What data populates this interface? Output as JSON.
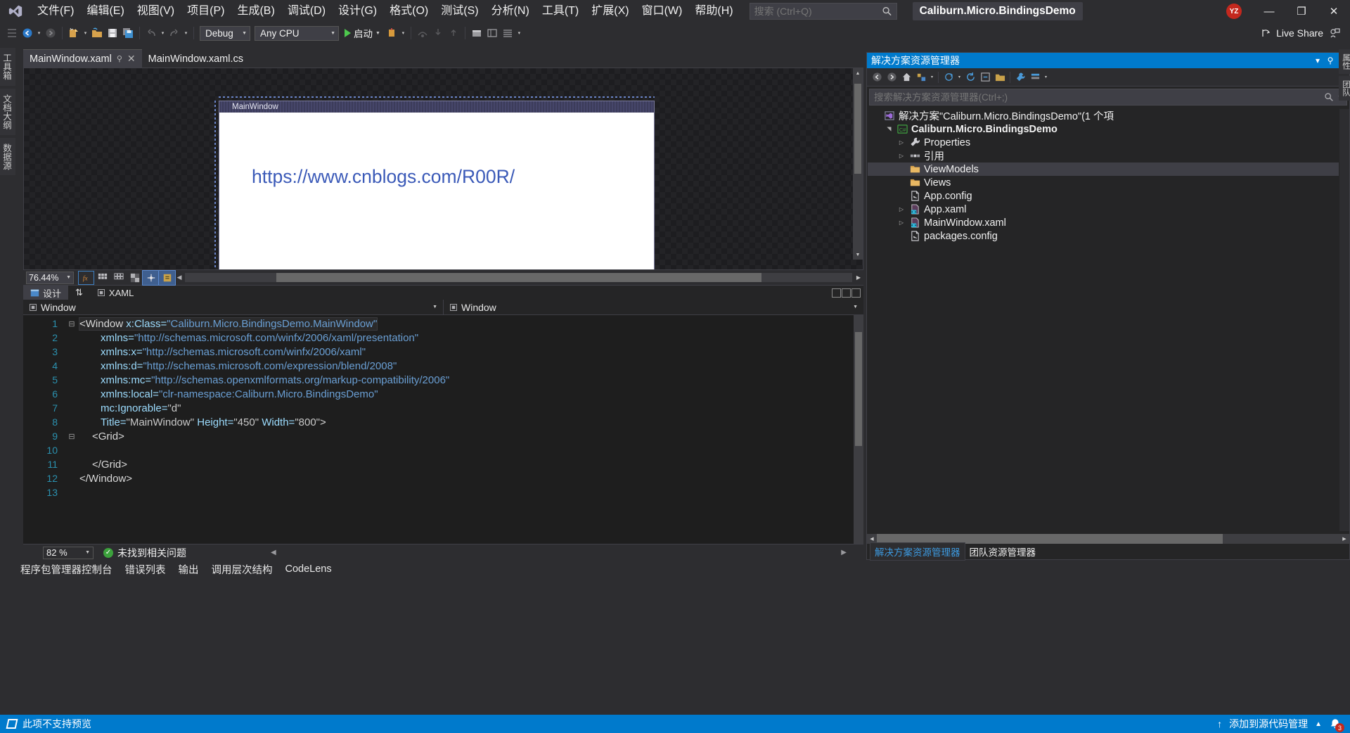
{
  "app": {
    "solution_name": "Caliburn.Micro.BindingsDemo",
    "account_initials": "YZ"
  },
  "menubar": {
    "items": [
      {
        "label": "文件(F)"
      },
      {
        "label": "编辑(E)"
      },
      {
        "label": "视图(V)"
      },
      {
        "label": "项目(P)"
      },
      {
        "label": "生成(B)"
      },
      {
        "label": "调试(D)"
      },
      {
        "label": "设计(G)"
      },
      {
        "label": "格式(O)"
      },
      {
        "label": "测试(S)"
      },
      {
        "label": "分析(N)"
      },
      {
        "label": "工具(T)"
      },
      {
        "label": "扩展(X)"
      },
      {
        "label": "窗口(W)"
      },
      {
        "label": "帮助(H)"
      }
    ],
    "search_placeholder": "搜索 (Ctrl+Q)",
    "minimize": "—",
    "maximize": "❐",
    "close": "✕"
  },
  "toolbar": {
    "config": "Debug",
    "platform": "Any CPU",
    "run_label": "启动",
    "live_share": "Live Share"
  },
  "left_rail": {
    "items": [
      "工具箱",
      "文档大纲",
      "数据源"
    ]
  },
  "doc_tabs": [
    {
      "label": "MainWindow.xaml",
      "active": true
    },
    {
      "label": "MainWindow.xaml.cs",
      "active": false
    }
  ],
  "designer": {
    "window_title": "MainWindow",
    "url_text": "https://www.cnblogs.com/R00R/",
    "url_color": "#3b5ab8",
    "zoom": "76.44%"
  },
  "split_tabs": {
    "design": "设计",
    "swap": "⇅",
    "xaml": "XAML"
  },
  "breadcrumbs": {
    "left": "Window",
    "right": "Window"
  },
  "code": {
    "lines": [
      {
        "n": "1",
        "fold": "⊟",
        "indent": 0,
        "tokens": [
          {
            "t": "<Window ",
            "c": "tk-elem"
          },
          {
            "t": "x:Class=",
            "c": "tk-attr"
          },
          {
            "t": "\"Caliburn.Micro.BindingsDemo.MainWindow\"",
            "c": "tk-ns"
          }
        ]
      },
      {
        "n": "2",
        "fold": "",
        "indent": 1,
        "tokens": [
          {
            "t": "xmlns=",
            "c": "tk-attr"
          },
          {
            "t": "\"http://schemas.microsoft.com/winfx/2006/xaml/presentation\"",
            "c": "tk-ns"
          }
        ]
      },
      {
        "n": "3",
        "fold": "",
        "indent": 1,
        "tokens": [
          {
            "t": "xmlns:x=",
            "c": "tk-attr"
          },
          {
            "t": "\"http://schemas.microsoft.com/winfx/2006/xaml\"",
            "c": "tk-ns"
          }
        ]
      },
      {
        "n": "4",
        "fold": "",
        "indent": 1,
        "tokens": [
          {
            "t": "xmlns:d=",
            "c": "tk-attr"
          },
          {
            "t": "\"http://schemas.microsoft.com/expression/blend/2008\"",
            "c": "tk-ns"
          }
        ]
      },
      {
        "n": "5",
        "fold": "",
        "indent": 1,
        "tokens": [
          {
            "t": "xmlns:mc=",
            "c": "tk-attr"
          },
          {
            "t": "\"http://schemas.openxmlformats.org/markup-compatibility/2006\"",
            "c": "tk-ns"
          }
        ]
      },
      {
        "n": "6",
        "fold": "",
        "indent": 1,
        "tokens": [
          {
            "t": "xmlns:local=",
            "c": "tk-attr"
          },
          {
            "t": "\"clr-namespace:Caliburn.Micro.BindingsDemo\"",
            "c": "tk-ns"
          }
        ]
      },
      {
        "n": "7",
        "fold": "",
        "indent": 1,
        "tokens": [
          {
            "t": "mc:Ignorable=",
            "c": "tk-attr"
          },
          {
            "t": "\"d\"",
            "c": "tk-val"
          }
        ]
      },
      {
        "n": "8",
        "fold": "",
        "indent": 1,
        "tokens": [
          {
            "t": "Title=",
            "c": "tk-attr"
          },
          {
            "t": "\"MainWindow\" ",
            "c": "tk-val"
          },
          {
            "t": "Height=",
            "c": "tk-attr"
          },
          {
            "t": "\"450\" ",
            "c": "tk-val"
          },
          {
            "t": "Width=",
            "c": "tk-attr"
          },
          {
            "t": "\"800\"",
            "c": "tk-val"
          },
          {
            "t": ">",
            "c": "tk-punct"
          }
        ]
      },
      {
        "n": "9",
        "fold": "⊟",
        "indent": 0.6,
        "tokens": [
          {
            "t": "<Grid>",
            "c": "tk-elem"
          }
        ]
      },
      {
        "n": "10",
        "fold": "",
        "indent": 1,
        "tokens": []
      },
      {
        "n": "11",
        "fold": "",
        "indent": 0.6,
        "tokens": [
          {
            "t": "</Grid>",
            "c": "tk-elem"
          }
        ]
      },
      {
        "n": "12",
        "fold": "",
        "indent": 0,
        "tokens": [
          {
            "t": "</Window>",
            "c": "tk-elem"
          }
        ]
      },
      {
        "n": "13",
        "fold": "",
        "indent": 0,
        "tokens": []
      }
    ]
  },
  "editor_status": {
    "zoom": "82 %",
    "issues": "未找到相关问题"
  },
  "bottom_tabs": [
    {
      "label": "程序包管理器控制台"
    },
    {
      "label": "错误列表"
    },
    {
      "label": "输出"
    },
    {
      "label": "调用层次结构"
    },
    {
      "label": "CodeLens"
    }
  ],
  "solution_explorer": {
    "title": "解决方案资源管理器",
    "pin": "⚲",
    "close": "✕",
    "caret": "▾",
    "search_placeholder": "搜索解决方案资源管理器(Ctrl+;)",
    "tree": [
      {
        "label": "解决方案\"Caliburn.Micro.BindingsDemo\"(1 个項",
        "icon": "solution-icon",
        "expander": "",
        "depth": 0,
        "bold": false,
        "selected": false
      },
      {
        "label": "Caliburn.Micro.BindingsDemo",
        "icon": "csproj-icon",
        "expander": "▴",
        "depth": 1,
        "bold": true,
        "selected": false
      },
      {
        "label": "Properties",
        "icon": "wrench-icon",
        "expander": "▸",
        "depth": 2,
        "bold": false,
        "selected": false
      },
      {
        "label": "引用",
        "icon": "references-icon",
        "expander": "▸",
        "depth": 2,
        "bold": false,
        "selected": false
      },
      {
        "label": "ViewModels",
        "icon": "folder-icon",
        "expander": "",
        "depth": 2,
        "bold": false,
        "selected": true
      },
      {
        "label": "Views",
        "icon": "folder-icon",
        "expander": "",
        "depth": 2,
        "bold": false,
        "selected": false
      },
      {
        "label": "App.config",
        "icon": "config-icon",
        "expander": "",
        "depth": 2,
        "bold": false,
        "selected": false
      },
      {
        "label": "App.xaml",
        "icon": "xaml-icon",
        "expander": "▸",
        "depth": 2,
        "bold": false,
        "selected": false
      },
      {
        "label": "MainWindow.xaml",
        "icon": "xaml-icon",
        "expander": "▸",
        "depth": 2,
        "bold": false,
        "selected": false
      },
      {
        "label": "packages.config",
        "icon": "config-icon",
        "expander": "",
        "depth": 2,
        "bold": false,
        "selected": false
      }
    ],
    "footer_tabs": [
      {
        "label": "解决方案资源管理器",
        "active": true
      },
      {
        "label": "团队资源管理器",
        "active": false
      }
    ]
  },
  "right_rail": {
    "items": [
      "属性",
      "团队"
    ]
  },
  "statusbar": {
    "message": "此项不支持预览",
    "source_control": "添加到源代码管理",
    "up_arrow": "↑",
    "caret": "▲",
    "notifications": "3",
    "accent": "#007acc"
  }
}
